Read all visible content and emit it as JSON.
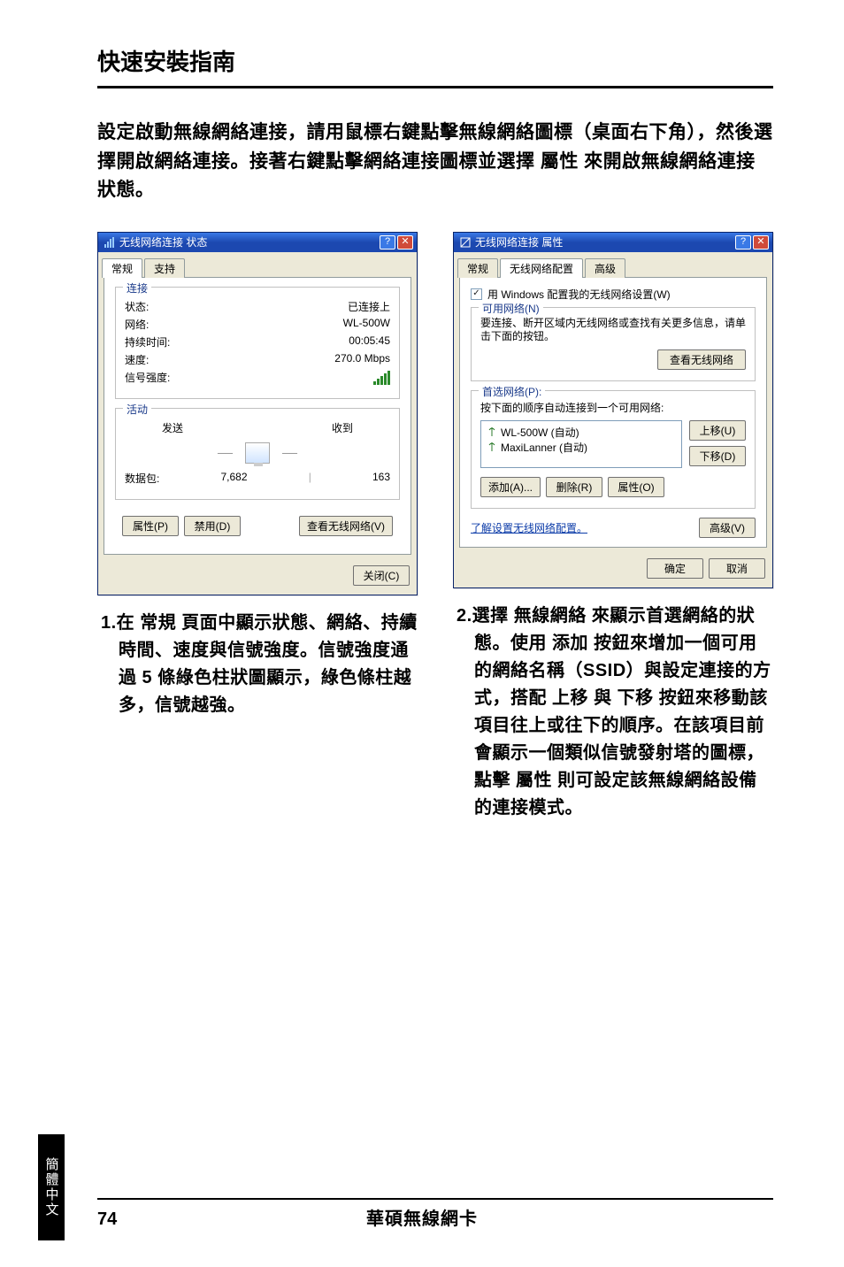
{
  "page": {
    "title": "快速安裝指南",
    "intro": "設定啟動無線網絡連接，請用鼠標右鍵點擊無線網絡圖標（桌面右下角），然後選擇開啟網絡連接。接著右鍵點擊網絡連接圖標並選擇 屬性 來開啟無線網絡連接狀態。",
    "side_tab": "簡體中文",
    "page_number": "74",
    "footer": "華碩無線網卡"
  },
  "left": {
    "dialog_title": "无线网络连接 状态",
    "tabs": {
      "general": "常规",
      "support": "支持"
    },
    "group_connect": "连接",
    "fields": {
      "status_label": "状态:",
      "status_value": "已连接上",
      "network_label": "网络:",
      "network_value": "WL-500W",
      "duration_label": "持续时间:",
      "duration_value": "00:05:45",
      "speed_label": "速度:",
      "speed_value": "270.0 Mbps",
      "signal_label": "信号强度:"
    },
    "group_activity": "活动",
    "activity": {
      "sent_label": "发送",
      "recv_label": "收到",
      "packets_label": "数据包:",
      "sent_value": "7,682",
      "recv_value": "163"
    },
    "buttons": {
      "properties": "属性(P)",
      "disable": "禁用(D)",
      "view": "查看无线网络(V)",
      "close": "关闭(C)"
    },
    "caption": "1.在 常規 頁面中顯示狀態、網絡、持續時間、速度與信號強度。信號強度通過 5 條綠色柱狀圖顯示，綠色條柱越多，信號越強。"
  },
  "right": {
    "dialog_title": "无线网络连接 属性",
    "tabs": {
      "general": "常规",
      "wireless": "无线网络配置",
      "advanced": "高级"
    },
    "use_windows": "用 Windows 配置我的无线网络设置(W)",
    "group_available": "可用网络(N)",
    "available_hint": "要连接、断开区域内无线网络或查找有关更多信息，请单击下面的按钮。",
    "view_networks_btn": "查看无线网络",
    "group_preferred": "首选网络(P):",
    "preferred_hint": "按下面的顺序自动连接到一个可用网络:",
    "networks": {
      "n1": "WL-500W (自动)",
      "n2": "MaxiLanner (自动)"
    },
    "buttons": {
      "up": "上移(U)",
      "down": "下移(D)",
      "add": "添加(A)...",
      "remove": "删除(R)",
      "properties": "属性(O)",
      "advanced": "高级(V)",
      "ok": "确定",
      "cancel": "取消"
    },
    "learn_link": "了解设置无线网络配置。",
    "caption": "2.選擇 無線網絡 來顯示首選網絡的狀態。使用 添加 按鈕來增加一個可用的網絡名稱（SSID）與設定連接的方式，搭配 上移 與 下移 按鈕來移動該項目往上或往下的順序。在該項目前會顯示一個類似信號發射塔的圖標，點擊 屬性 則可設定該無線網絡設備的連接模式。"
  }
}
